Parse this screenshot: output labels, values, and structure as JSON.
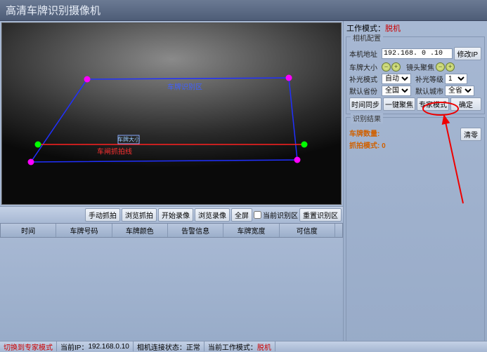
{
  "title": "高清车牌识别摄像机",
  "video": {
    "blue_label": "车牌识别区",
    "red_label": "车闸抓拍线",
    "size_label": "车牌大小"
  },
  "toolbar": {
    "manual_snap": "手动抓拍",
    "browse_snap": "浏览抓拍",
    "start_record": "开始录像",
    "browse_record": "浏览录像",
    "fullscreen": "全屏",
    "show_current": "当前识别区",
    "reset_zone": "重置识别区"
  },
  "columns": {
    "time": "时间",
    "plate": "车牌号码",
    "color": "车牌颜色",
    "alarm": "告警信息",
    "width": "车牌宽度",
    "conf": "可信度"
  },
  "right": {
    "workmode_label": "工作模式：",
    "workmode_value": "脱机",
    "camera_group": "相机配置",
    "ip_label": "本机地址",
    "ip_value": "192.168. 0 .10",
    "change_ip": "修改IP",
    "plate_size": "车牌大小",
    "lens_focus": "镜头聚焦",
    "light_mode": "补光模式",
    "light_mode_value": "自动",
    "light_level": "补光等级",
    "light_level_value": "1",
    "default_prov": "默认省份",
    "default_prov_value": "全国",
    "default_city": "默认城市",
    "default_city_value": "全省",
    "time_sync": "时间同步",
    "one_key_focus": "一键聚焦",
    "expert_mode": "专家模式",
    "confirm": "确定",
    "result_group": "识别结果",
    "stat1": "车牌数量:",
    "stat2": "抓拍模式: 0",
    "clear": "清零"
  },
  "status": {
    "switch_expert": "切换到专家模式",
    "current_ip_label": "当前IP：",
    "current_ip": "192.168.0.10",
    "conn_label": "相机连接状态：",
    "conn_value": "正常",
    "cur_mode_label": "当前工作模式：",
    "cur_mode_value": "脱机"
  }
}
